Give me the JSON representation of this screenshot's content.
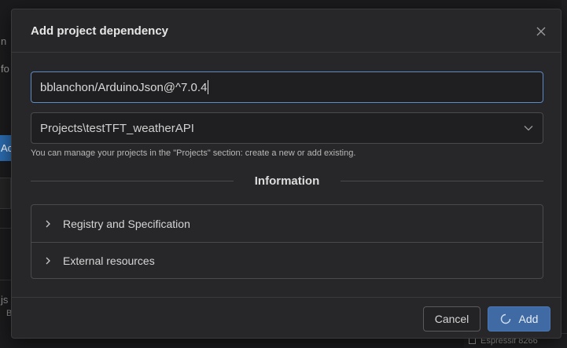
{
  "background": {
    "fragment_top": "n",
    "fragment_fo": "fo",
    "fragment_accent_btn": "Ac",
    "fragment_js": "js",
    "fragment_b": "B",
    "status_text": "Espressif 8266"
  },
  "dialog": {
    "title": "Add project dependency",
    "dependency_input": {
      "value": "bblanchon/ArduinoJson@^7.0.4"
    },
    "project_select": {
      "selected": "Projects\\testTFT_weatherAPI"
    },
    "hint": "You can manage your projects in the \"Projects\" section: create a new or add existing.",
    "section_title": "Information",
    "accordion": [
      {
        "label": "Registry and Specification"
      },
      {
        "label": "External resources"
      }
    ],
    "buttons": {
      "cancel": "Cancel",
      "add": "Add"
    }
  },
  "colors": {
    "accent": "#3f6aa3",
    "focus_border": "#5b8bc7",
    "dialog_bg": "#272729"
  },
  "icons": {
    "close": "close-icon",
    "chevron_down": "chevron-down-icon",
    "chevron_right": "chevron-right-icon",
    "spinner": "loading-spinner-icon"
  }
}
